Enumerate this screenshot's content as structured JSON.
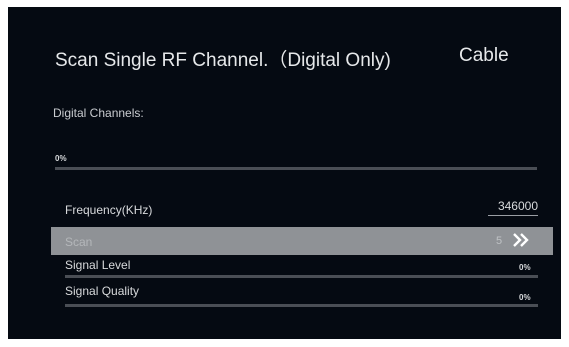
{
  "header": {
    "title": "Scan Single RF Channel.（Digital Only)",
    "mode": "Cable"
  },
  "digital": {
    "label": "Digital Channels:",
    "progress_text": "0%",
    "progress_value": 0
  },
  "frequency": {
    "label": "Frequency(KHz)",
    "value": "346000"
  },
  "scan": {
    "label": "Scan",
    "count": "5",
    "icon": "double-chevron-right-icon"
  },
  "signal_level": {
    "label": "Signal Level",
    "text": "0%",
    "value": 0
  },
  "signal_quality": {
    "label": "Signal Quality",
    "text": "0%",
    "value": 0
  },
  "colors": {
    "background": "#050a12",
    "highlight": "#8f9296",
    "text": "#e8eaec",
    "track": "#4a4e55"
  }
}
